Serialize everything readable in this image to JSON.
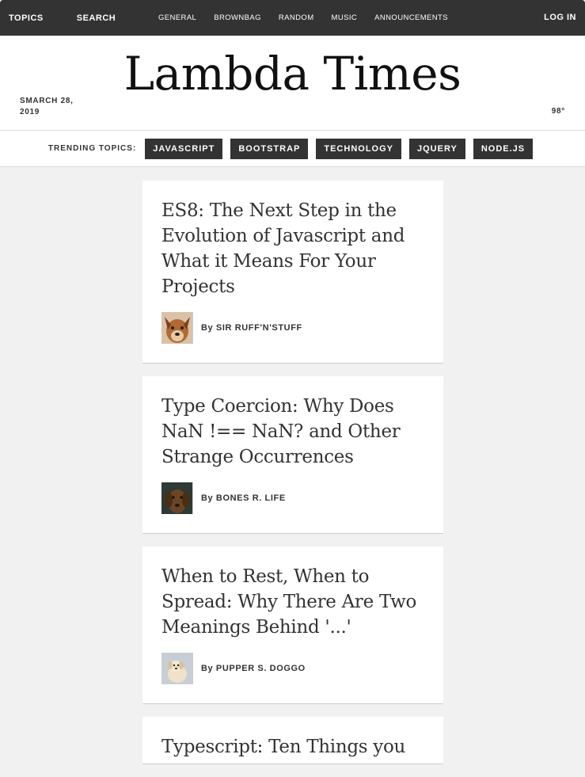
{
  "topbar": {
    "left": [
      "TOPICS",
      "SEARCH"
    ],
    "nav": [
      "GENERAL",
      "BROWNBAG",
      "RANDOM",
      "MUSIC",
      "ANNOUNCEMENTS"
    ],
    "login": "LOG IN"
  },
  "header": {
    "date": "SMARCH 28, 2019",
    "title": "Lambda Times",
    "temp": "98°"
  },
  "trending": {
    "label": "TRENDING TOPICS:",
    "tags": [
      "JAVASCRIPT",
      "BOOTSTRAP",
      "TECHNOLOGY",
      "JQUERY",
      "NODE.JS"
    ]
  },
  "cards": [
    {
      "headline": "ES8: The Next Step in the Evolution of Javascript and What it Means For Your Projects",
      "by": "By",
      "author": "SIR RUFF'N'STUFF",
      "avatar": "dog-avatar-ruff"
    },
    {
      "headline": "Type Coercion: Why Does NaN !== NaN? and Other Strange Occurrences",
      "by": "By",
      "author": "BONES R. LIFE",
      "avatar": "dog-avatar-bones"
    },
    {
      "headline": "When to Rest, When to Spread: Why There Are Two Meanings Behind '...'",
      "by": "By",
      "author": "PUPPER S. DOGGO",
      "avatar": "dog-avatar-pupper"
    },
    {
      "headline": "Typescript: Ten Things you"
    }
  ],
  "colors": {
    "bar": "#333333",
    "bg": "#f1f1f1",
    "card": "#ffffff"
  }
}
